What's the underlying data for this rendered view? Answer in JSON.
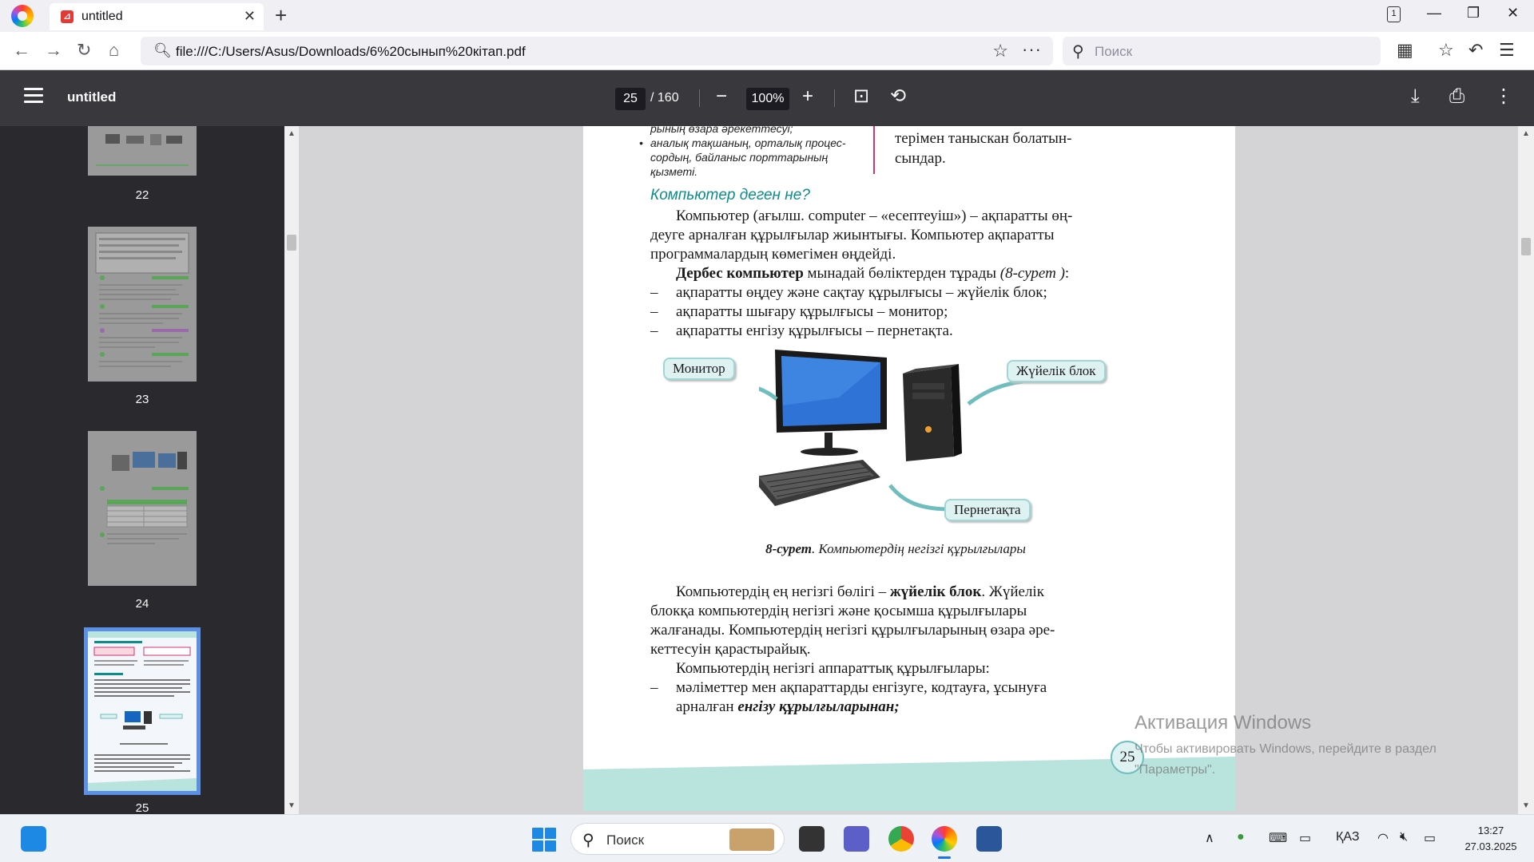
{
  "browser": {
    "tab_title": "untitled",
    "new_tab_symbol": "+",
    "tab_close_symbol": "✕",
    "tab_count": "1",
    "url": "file:///C:/Users/Asus/Downloads/6%20сынып%20кітап.pdf",
    "search_placeholder": "Поиск"
  },
  "pdf_toolbar": {
    "title": "untitled",
    "current_page": "25",
    "total_pages": "/ 160",
    "zoom": "100%"
  },
  "sidebar": {
    "thumbnails": [
      {
        "label": "22"
      },
      {
        "label": "23"
      },
      {
        "label": "24"
      },
      {
        "label": "25",
        "selected": true
      }
    ]
  },
  "page": {
    "top_bullets": [
      "рының өзара әрекеттесуі;",
      "аналық тақшаның, орталық процес-",
      "сордың, байланыс порттарының",
      "қызметі."
    ],
    "top_right_lines": [
      "терімен    таныскан    болатын-",
      "сындар."
    ],
    "section_heading": "Компьютер деген не?",
    "para1_lines": [
      "Компьютер (ағылш. computer – «есептеуіш») – ақпаратты өң-",
      "деуге арналған құрылғылар жиынтығы. Компьютер ақпаратты",
      "программалардың көмегімен өңдейді."
    ],
    "para2_bold": "Дербес компьютер",
    "para2_rest": " мынадай бөліктерден тұрады ",
    "para2_ref": "(8-сурет )",
    "para2_end": ":",
    "dash_items": [
      "ақпаратты өңдеу және сақтау құрылғысы – жүйелік блок;",
      "ақпаратты шығару құрылғысы – монитор;",
      "ақпаратты енгізу құрылғысы – пернетақта."
    ],
    "dash_symbol": "–",
    "callouts": {
      "monitor": "Монитор",
      "system_unit": "Жүйелік блок",
      "keyboard": "Пернетақта"
    },
    "caption_bold": "8-сурет",
    "caption_rest": ". Компьютердің негізгі құрылғылары",
    "para3_lines": [
      {
        "pre": "Компьютердің ең негізгі бөлігі – ",
        "bold": "жүйелік блок",
        "post": ". Жүйелік"
      },
      {
        "text": "блокқа компьютердің негізгі және қосымша құрылғылары"
      },
      {
        "text": "жалғанады. Компьютердің негізгі құрылғыларының өзара әре-"
      },
      {
        "text": "кеттесуін қарастырайық."
      }
    ],
    "para4": "Компьютердің негізгі аппараттық құрылғылары:",
    "dash_item_last_1": "мәліметтер мен ақпараттарды енгізуге, кодтауға, ұсынуға",
    "dash_item_last_2_pre": "арналған ",
    "dash_item_last_2_em": "енгізу құрылғыларынан;",
    "page_number": "25"
  },
  "watermark": {
    "title": "Активация Windows",
    "line1": "Чтобы активировать Windows, перейдите в раздел",
    "line2": "\"Параметры\"."
  },
  "taskbar": {
    "search_text": "Поиск",
    "language": "ҚАЗ",
    "time": "13:27",
    "date": "27.03.2025"
  },
  "colors": {
    "pdf_toolbar": "#38383d",
    "sidebar": "#2a2a2e",
    "accent": "#0d8c8c",
    "selection": "#5c8fe6"
  }
}
